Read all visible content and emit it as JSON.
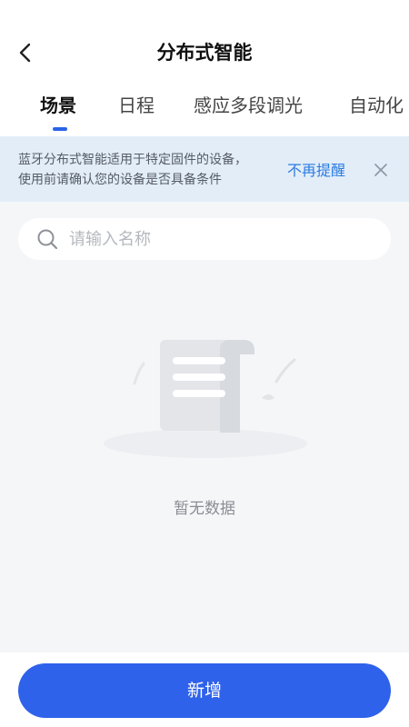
{
  "header": {
    "title": "分布式智能",
    "back_icon": "chevron-left-icon"
  },
  "tabs": [
    {
      "label": "场景",
      "active": true
    },
    {
      "label": "日程",
      "active": false
    },
    {
      "label": "感应多段调光",
      "active": false
    },
    {
      "label": "自动化",
      "active": false
    }
  ],
  "notice": {
    "line1": "蓝牙分布式智能适用于特定固件的设备，",
    "line2": "使用前请确认您的设备是否具备条件",
    "action": "不再提醒",
    "close_icon": "close-icon"
  },
  "search": {
    "placeholder": "请输入名称",
    "value": "",
    "icon": "search-icon"
  },
  "empty_state": {
    "text": "暂无数据",
    "icon": "empty-document-icon"
  },
  "footer": {
    "add_label": "新增"
  },
  "colors": {
    "accent": "#2f62ea",
    "link": "#2c7be0",
    "notice_bg": "#e2edf8",
    "page_bg": "#f5f6f8"
  }
}
